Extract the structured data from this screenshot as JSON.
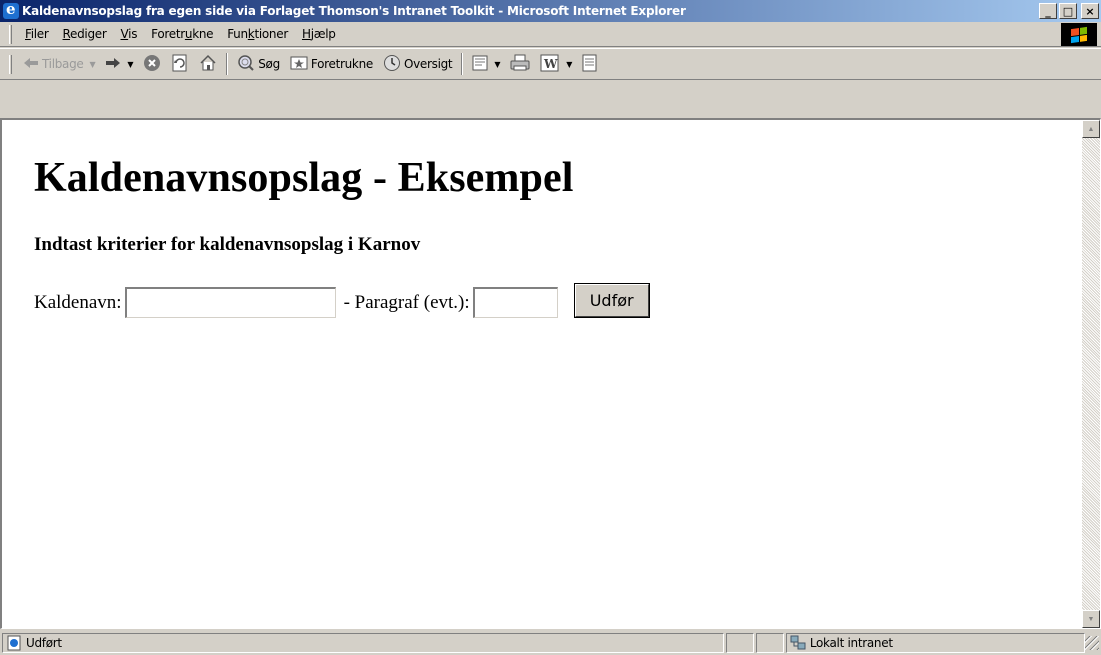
{
  "window": {
    "title": "Kaldenavnsopslag fra egen side via Forlaget Thomson's Intranet Toolkit - Microsoft Internet Explorer",
    "minimize": "_",
    "maximize": "□",
    "close": "×"
  },
  "menu": {
    "items": [
      {
        "u": "F",
        "rest": "iler"
      },
      {
        "u": "R",
        "rest": "ediger"
      },
      {
        "u": "V",
        "rest": "is"
      },
      {
        "pre": "Foretr",
        "u": "u",
        "rest": "kne"
      },
      {
        "pre": "Fun",
        "u": "k",
        "rest": "tioner"
      },
      {
        "u": "H",
        "rest": "jælp"
      }
    ]
  },
  "toolbar": {
    "back": "Tilbage",
    "search": "Søg",
    "favorites": "Foretrukne",
    "history": "Oversigt",
    "icons": {
      "back": "arrow-left-icon",
      "forward": "arrow-right-icon",
      "stop": "stop-icon",
      "refresh": "refresh-icon",
      "home": "home-icon",
      "search": "search-icon",
      "favorites": "favorites-icon",
      "history": "history-icon",
      "mail": "mail-icon",
      "print": "print-icon",
      "edit": "word-edit-icon",
      "discuss": "discuss-icon"
    }
  },
  "page": {
    "title": "Kaldenavnsopslag - Eksempel",
    "subtitle": "Indtast kriterier for kaldenavnsopslag i Karnov",
    "form": {
      "name_label": "Kaldenavn:",
      "name_value": "",
      "paragraph_label": "- Paragraf (evt.):",
      "paragraph_value": "",
      "submit": "Udfør"
    }
  },
  "status": {
    "text": "Udført",
    "zone": "Lokalt intranet"
  },
  "colors": {
    "titlebar_start": "#0a246a",
    "titlebar_end": "#a6caf0",
    "chrome": "#d4d0c8"
  }
}
